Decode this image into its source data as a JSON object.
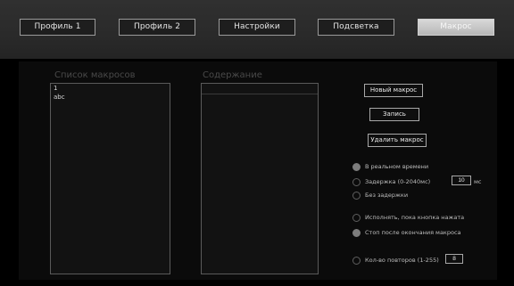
{
  "tabs": [
    {
      "label": "Профиль 1"
    },
    {
      "label": "Профиль 2"
    },
    {
      "label": "Настройки"
    },
    {
      "label": "Подсветка"
    },
    {
      "label": "Макрос"
    }
  ],
  "active_tab": "Макрос",
  "macro_list": {
    "label": "Список макросов",
    "items": [
      "1",
      "abc"
    ]
  },
  "content": {
    "label": "Содержание"
  },
  "buttons": {
    "new_macro": "Новый макрос",
    "record": "Запись",
    "delete_macro": "Удалить макрос"
  },
  "timing": {
    "realtime": "В реальном времени",
    "delay": "Задержка (0-2040мс)",
    "delay_value": "10",
    "delay_unit": "мс",
    "no_delay": "Без задержки",
    "selected": "realtime"
  },
  "execution": {
    "while_held": "Исполнять, пока кнопка нажата",
    "stop_after": "Стоп после окончания макроса",
    "repeat_count": "Кол-во повторов (1-255)",
    "repeat_value": "8",
    "selected": "stop_after"
  },
  "colors": {
    "background": "#000000",
    "top_band": "#2a2a2a",
    "panel": "#0b0b0b",
    "active_tab": "#c8c8c8",
    "border": "#9a9a9a",
    "radio_selected": "#7d7d7d"
  }
}
